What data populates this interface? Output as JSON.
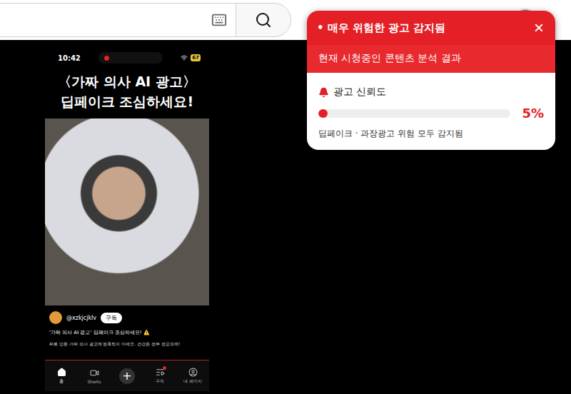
{
  "phone": {
    "status_time": "10:42",
    "recording": true,
    "battery": "67",
    "headline": [
      "〈가짜 의사 AI 광고〉",
      "딥페이크 조심하세요!"
    ],
    "channel": {
      "handle": "@xzkjcjklv",
      "subscribe": "구독"
    },
    "video_title": "'가짜 의사 AI 광고' 딥페이크 조심하세요! ⚠️",
    "description": "AI로 만든 가짜 의사 광고에 현혹되지 마세요. 건강은 전부 전문의께!",
    "nav": [
      {
        "label": "홈",
        "kind": "home",
        "selected": true,
        "badge": false
      },
      {
        "label": "Shorts",
        "kind": "shorts",
        "selected": false,
        "badge": false
      },
      {
        "label": "+",
        "kind": "create",
        "selected": false,
        "badge": false
      },
      {
        "label": "구독",
        "kind": "subs",
        "selected": false,
        "badge": true
      },
      {
        "label": "내 페이지",
        "kind": "me",
        "selected": false,
        "badge": false
      }
    ]
  },
  "alert": {
    "bullet": "•",
    "title": "매우 위험한 광고 감지됨",
    "close": "×",
    "subtitle": "현재 시청중인 콘텐츠 분석 결과",
    "meter": {
      "label": "광고 신뢰도",
      "level": 0.05,
      "reading": "5%"
    },
    "note": "딥페이크 · 과장광고 위험 모두 감지됨"
  }
}
